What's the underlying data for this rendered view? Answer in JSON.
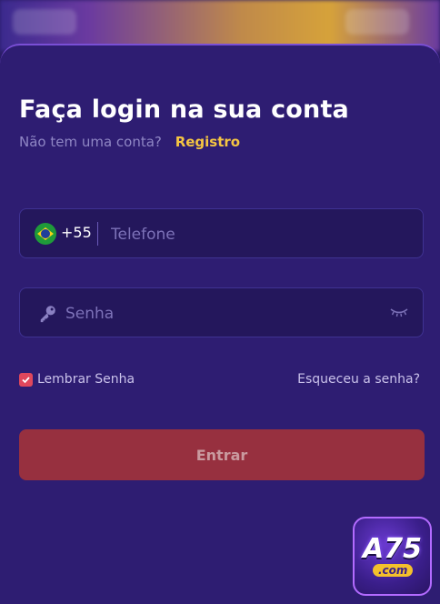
{
  "login": {
    "title": "Faça login na sua conta",
    "subtitle": "Não tem uma conta?",
    "register_link": "Registro"
  },
  "phone_field": {
    "country_code": "+55",
    "country_flag": "brazil-flag-icon",
    "placeholder": "Telefone",
    "value": ""
  },
  "password_field": {
    "placeholder": "Senha",
    "value": "",
    "leading_icon": "key-icon",
    "trailing_icon": "eye-closed-icon"
  },
  "remember": {
    "label": "Lembrar Senha",
    "checked": true
  },
  "forgot_link": "Esqueceu a senha?",
  "submit": {
    "label": "Entrar"
  },
  "logo": {
    "brand": "A75",
    "suffix": ".com"
  },
  "colors": {
    "background": "#2e1d72",
    "accent_link": "#f5c542",
    "button": "#97303f",
    "checkbox": "#e0475c"
  }
}
